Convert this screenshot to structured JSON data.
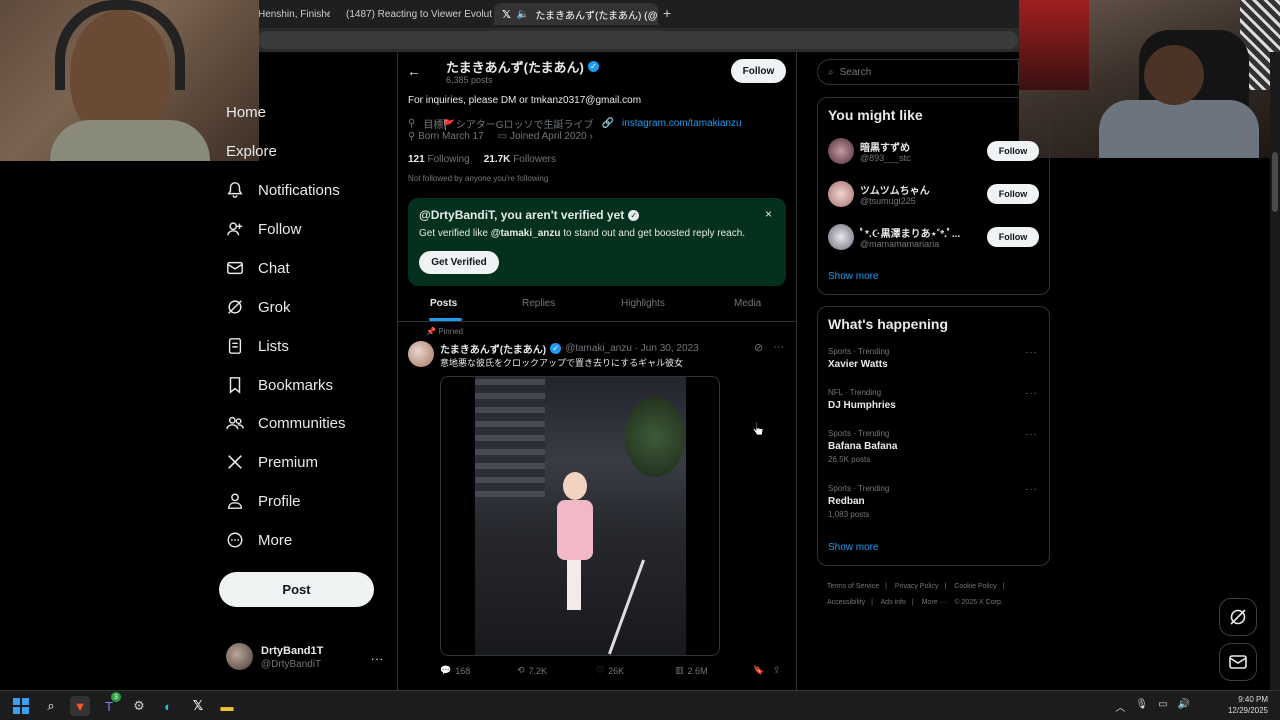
{
  "browser": {
    "tabs": [
      {
        "label": "Henshin, Finisher"
      },
      {
        "label": "(1487) Reacting to Viewer Evolutions"
      },
      {
        "label": "たまきあんず(たまあん) (@tamak"
      }
    ],
    "new_tab": "+"
  },
  "nav": {
    "items": [
      {
        "label": "Home"
      },
      {
        "label": "Explore"
      },
      {
        "label": "Notifications"
      },
      {
        "label": "Follow"
      },
      {
        "label": "Chat"
      },
      {
        "label": "Grok"
      },
      {
        "label": "Lists"
      },
      {
        "label": "Bookmarks"
      },
      {
        "label": "Communities"
      },
      {
        "label": "Premium"
      },
      {
        "label": "Profile"
      },
      {
        "label": "More"
      }
    ],
    "post_button": "Post",
    "account": {
      "name": "DrtyBand1T",
      "handle": "@DrtyBandiT",
      "more": "..."
    }
  },
  "profile": {
    "name": "たまきあんず(たまあん)",
    "post_count": "6,385 posts",
    "follow_label": "Follow",
    "bio": "For inquiries, please DM or tmkanz0317@gmail.com",
    "location": "目標🚩シアターGロッソで生誕ライブ",
    "link": "instagram.com/tamakianzu",
    "born": "Born March 17",
    "joined": "Joined April 2020",
    "following_count": "121",
    "following_label": "Following",
    "followers_count": "21.7K",
    "followers_label": "Followers",
    "not_followed": "Not followed by anyone you're following"
  },
  "verify_banner": {
    "title": "@DrtyBandiT, you aren't verified yet",
    "desc_prefix": "Get verified like ",
    "desc_handle": "@tamaki_anzu",
    "desc_suffix": " to stand out and get boosted reply reach.",
    "button": "Get Verified",
    "close": "×"
  },
  "tabs": [
    "Posts",
    "Replies",
    "Highlights",
    "Media"
  ],
  "post": {
    "pinned": "Pinned",
    "author": "たまきあんず(たまあん)",
    "handle": "@tamaki_anzu · Jun 30, 2023",
    "text": "意地悪な彼氏をクロックアップで置き去りにするギャル彼女",
    "replies": "168",
    "reposts": "7.2K",
    "likes": "26K",
    "views": "2.6M"
  },
  "search": {
    "placeholder": "Search"
  },
  "you_might_like": {
    "title": "You might like",
    "users": [
      {
        "name": "暗黒すずめ",
        "handle": "@893___stc",
        "button": "Follow"
      },
      {
        "name": "ツムツムちゃん",
        "handle": "@tsumugi225",
        "button": "Follow"
      },
      {
        "name": "ﾟ*.☪︎黒澤まりあ⋆˚*.ﾟ...",
        "handle": "@mamamamariaria",
        "button": "Follow"
      }
    ],
    "show_more": "Show more"
  },
  "whats_happening": {
    "title": "What's happening",
    "trends": [
      {
        "context": "Sports · Trending",
        "name": "Xavier Watts",
        "posts": ""
      },
      {
        "context": "NFL · Trending",
        "name": "DJ Humphries",
        "posts": ""
      },
      {
        "context": "Sports · Trending",
        "name": "Bafana Bafana",
        "posts": "26.5K posts"
      },
      {
        "context": "Sports · Trending",
        "name": "Redban",
        "posts": "1,083 posts"
      }
    ],
    "show_more": "Show more"
  },
  "footer": {
    "links": [
      "Terms of Service",
      "|",
      "Privacy Policy",
      "|",
      "Cookie Policy",
      "|",
      "Accessibility",
      "|",
      "Ads info",
      "|",
      "More ···",
      "© 2025 X Corp."
    ]
  },
  "taskbar": {
    "time": "9:40 PM",
    "date": "12/29/2025",
    "badge": "3"
  }
}
